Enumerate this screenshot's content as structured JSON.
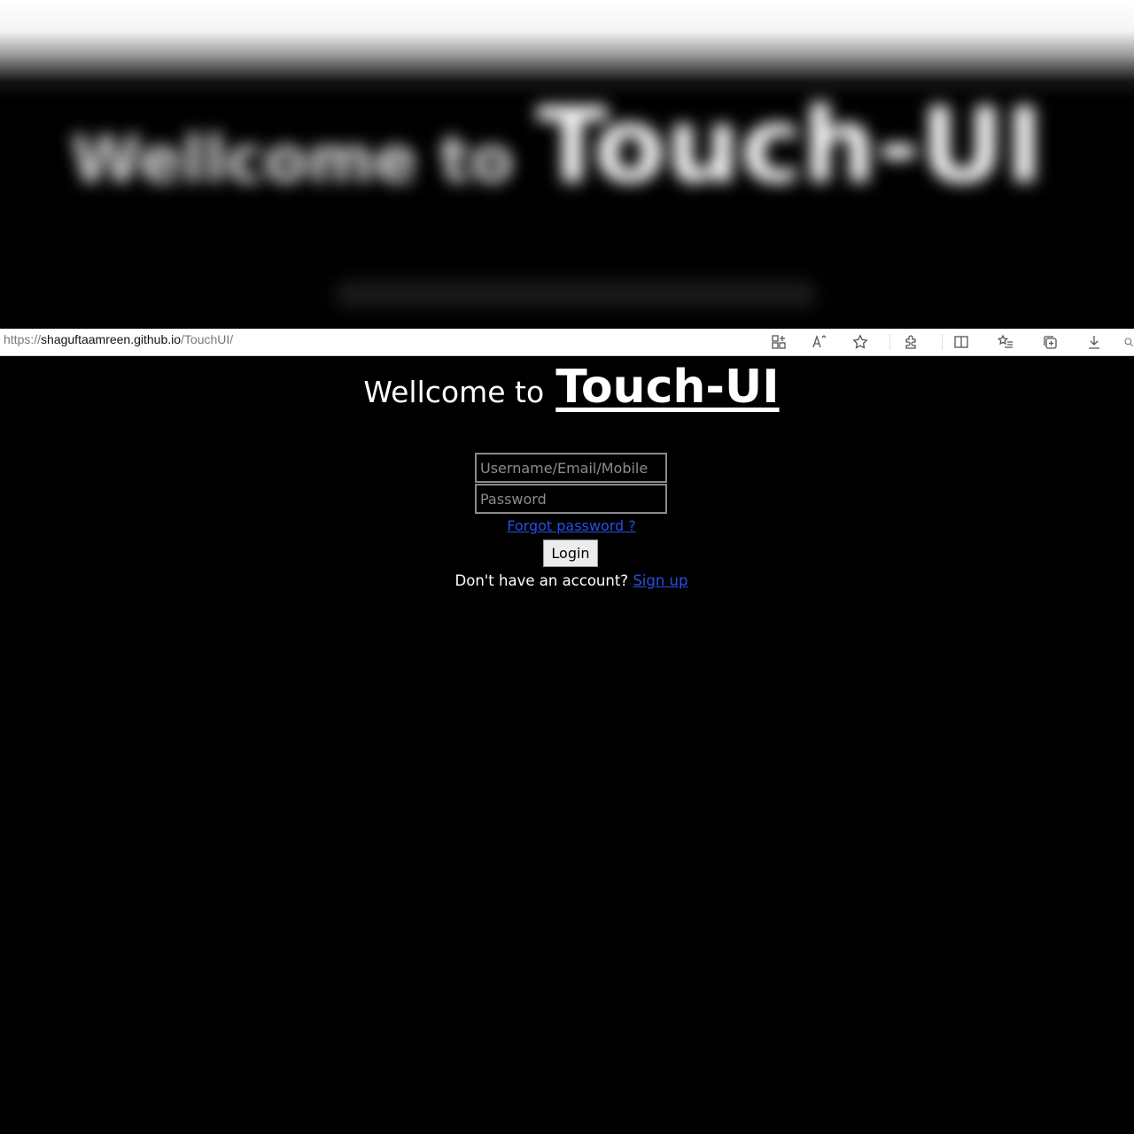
{
  "background_page": {
    "blurred_heading_prefix": "Wellcome to",
    "blurred_heading_brand": "Touch-UI"
  },
  "browser": {
    "url_scheme": "https://",
    "url_domain": "shaguftaamreen.github.io",
    "url_path": "/TouchUI/",
    "toolbar_icons": [
      "app-grid-icon",
      "read-aloud-icon",
      "favorite-star-icon",
      "extensions-icon",
      "split-screen-icon",
      "favorites-list-icon",
      "collections-icon",
      "downloads-icon",
      "more-icon"
    ]
  },
  "page": {
    "welcome_text": "Wellcome to",
    "brand_text": "Touch-UI",
    "username_placeholder": "Username/Email/Mobile",
    "password_placeholder": "Password",
    "forgot_link": "Forgot password ?",
    "login_button": "Login",
    "no_account_text": "Don't have an account?",
    "signup_link": "Sign up"
  },
  "colors": {
    "background": "#000000",
    "link": "#2b4de6",
    "text": "#ffffff"
  }
}
